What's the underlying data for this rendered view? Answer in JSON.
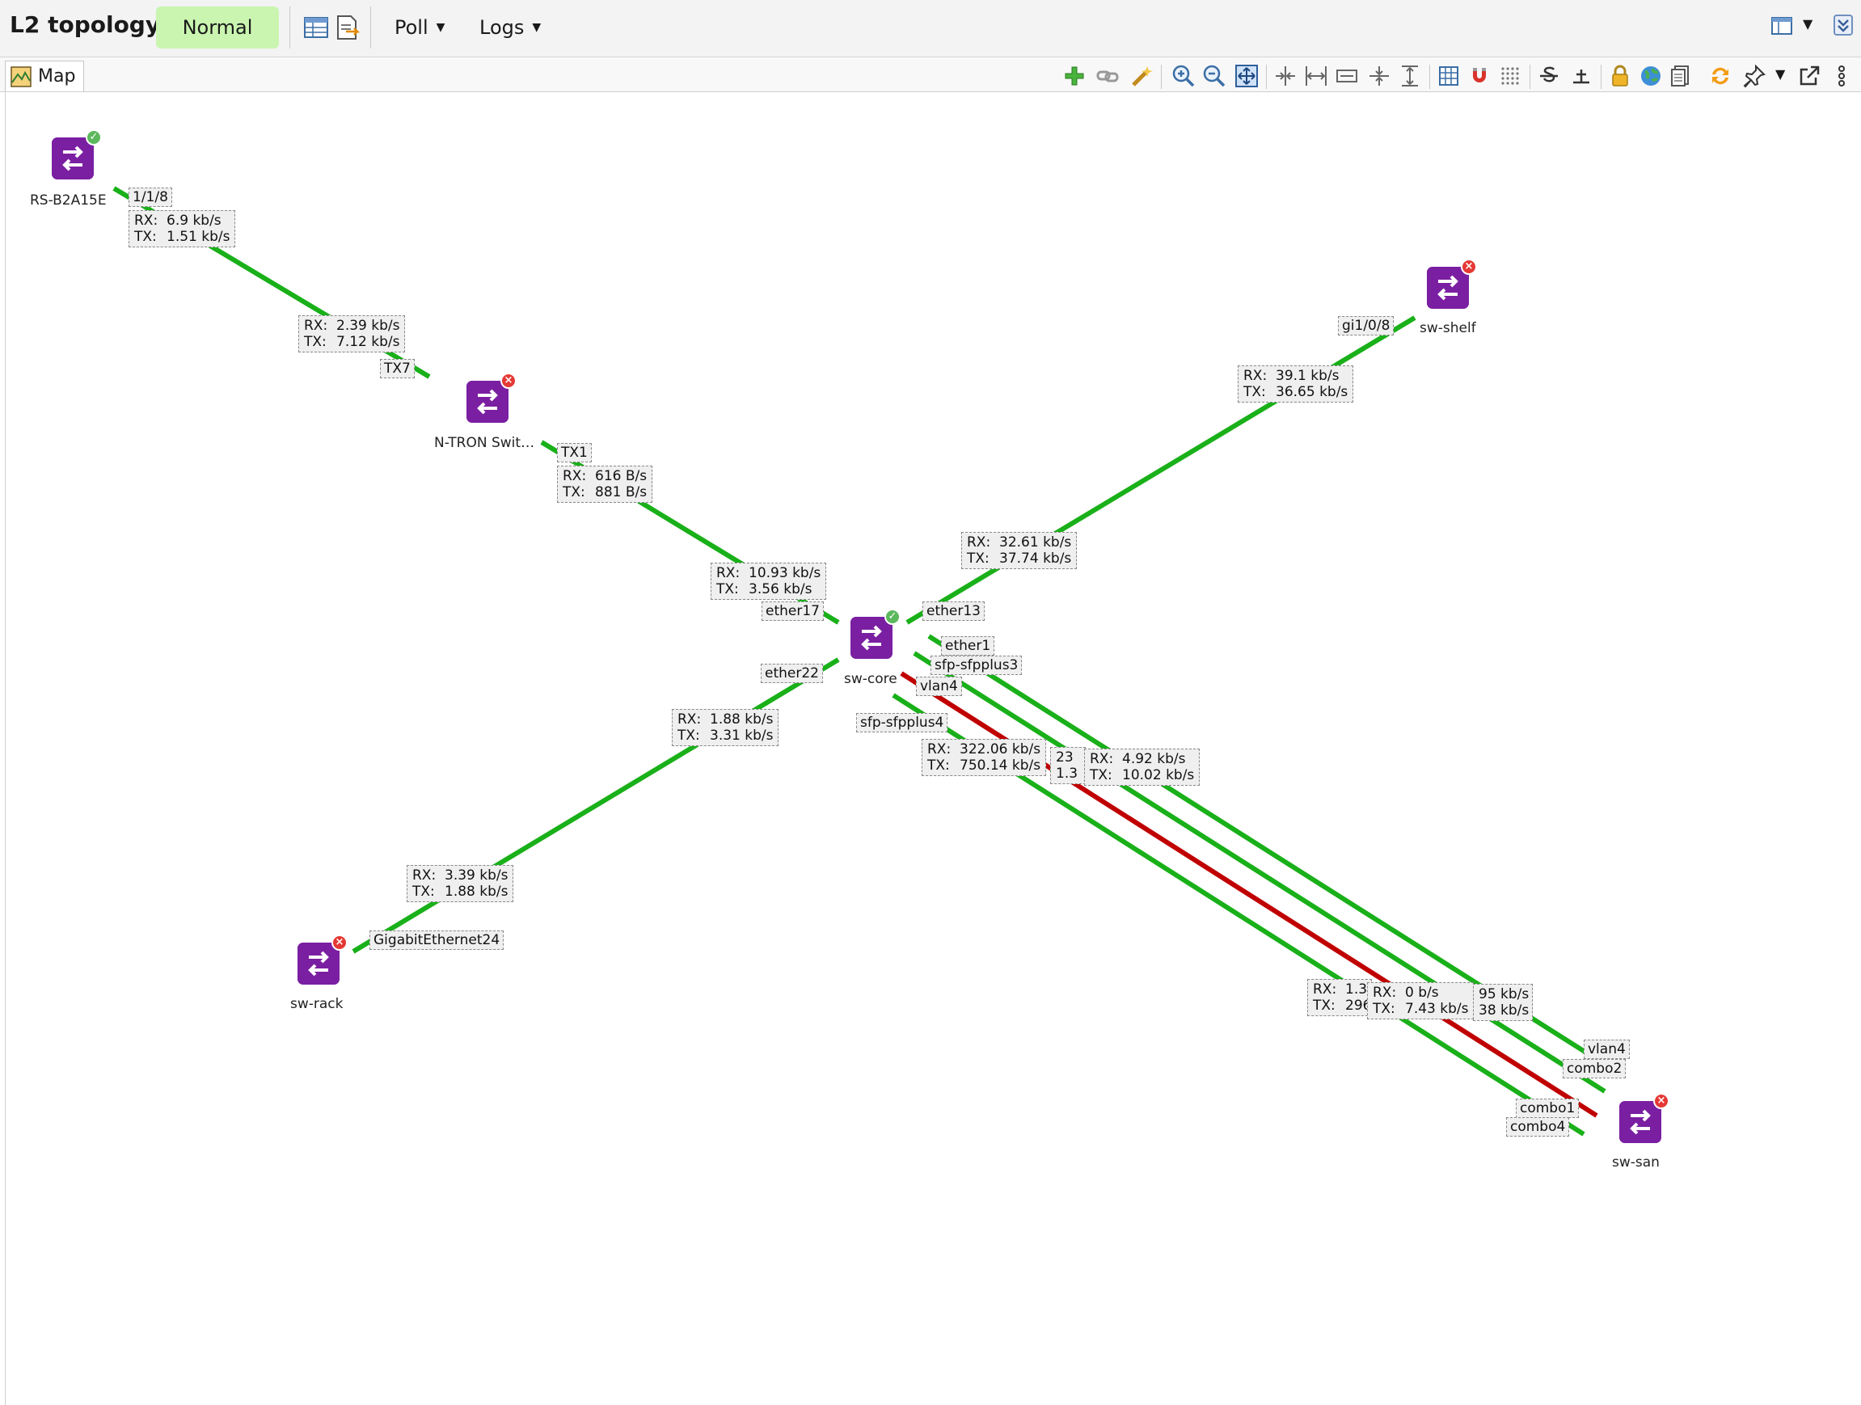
{
  "window": {
    "title": "L2 topology",
    "status": "Normal",
    "menus": {
      "poll": "Poll",
      "logs": "Logs"
    }
  },
  "tab": {
    "label": "Map"
  },
  "toolbar_icons": [
    "add-icon",
    "unlink-icon",
    "wand-icon",
    "zoom-in-icon",
    "zoom-out-icon",
    "zoom-fit-icon",
    "compress-h-icon",
    "expand-h-icon",
    "fit-width-icon",
    "compress-v-icon",
    "expand-v-icon",
    "grid-layout-icon",
    "magnet-icon",
    "dotted-grid-icon",
    "strikethrough-icon",
    "connect-icon",
    "lock-icon",
    "globe-icon",
    "document-icon",
    "sync-icon",
    "pin-icon",
    "chevron-down-icon",
    "external-link-icon",
    "more-icon"
  ],
  "colors": {
    "accent": "#7a1fa2",
    "link_ok": "#19b019",
    "link_down": "#c00000",
    "status_ok": "#5cb85c",
    "status_error": "#e53935",
    "badge_bg": "#c9f5b0"
  },
  "nodes": {
    "rs": {
      "name": "RS-B2A15E",
      "status": "ok"
    },
    "ntron": {
      "name": "N-TRON Swit…",
      "status": "error"
    },
    "core": {
      "name": "sw-core",
      "status": "ok"
    },
    "shelf": {
      "name": "sw-shelf",
      "status": "error"
    },
    "rack": {
      "name": "sw-rack",
      "status": "error"
    },
    "san": {
      "name": "sw-san",
      "status": "error"
    }
  },
  "ports": {
    "rs_1_1_8": "1/1/8",
    "ntron_tx7": "TX7",
    "ntron_tx1": "TX1",
    "core_ether17": "ether17",
    "core_ether13": "ether13",
    "core_ether1": "ether1",
    "core_sfp3": "sfp-sfpplus3",
    "core_vlan4": "vlan4",
    "core_ether22": "ether22",
    "core_sfp4": "sfp-sfpplus4",
    "shelf_gi": "gi1/0/8",
    "rack_gi24": "GigabitEthernet24",
    "san_vlan4": "vlan4",
    "san_combo2": "combo2",
    "san_combo1": "combo1",
    "san_combo4": "combo4"
  },
  "stats": {
    "rs_link": {
      "rx": "6.9 kb/s",
      "tx": "1.51 kb/s"
    },
    "ntron_up": {
      "rx": "2.39 kb/s",
      "tx": "7.12 kb/s"
    },
    "ntron_down": {
      "rx": "616 B/s",
      "tx": "881 B/s"
    },
    "core_ntron": {
      "rx": "10.93 kb/s",
      "tx": "3.56 kb/s"
    },
    "shelf_link": {
      "rx": "39.1 kb/s",
      "tx": "36.65 kb/s"
    },
    "core_shelf": {
      "rx": "32.61 kb/s",
      "tx": "37.74 kb/s"
    },
    "core_rack": {
      "rx": "1.88 kb/s",
      "tx": "3.31 kb/s"
    },
    "rack_link": {
      "rx": "3.39 kb/s",
      "tx": "1.88 kb/s"
    },
    "core_san_a": {
      "rx": "322.06 kb/s",
      "tx": "750.14 kb/s"
    },
    "core_san_b_partial": "23",
    "core_san_b_partial2": "1.3",
    "core_san_c": {
      "rx": "4.92 kb/s",
      "tx": "10.02 kb/s"
    },
    "san_a_partial": {
      "rx": "1.3",
      "tx": "296"
    },
    "san_b": {
      "rx": "0 b/s",
      "tx": "7.43 kb/s"
    },
    "san_c_partial": {
      "rx": "95 kb/s",
      "tx": "38 kb/s"
    }
  }
}
